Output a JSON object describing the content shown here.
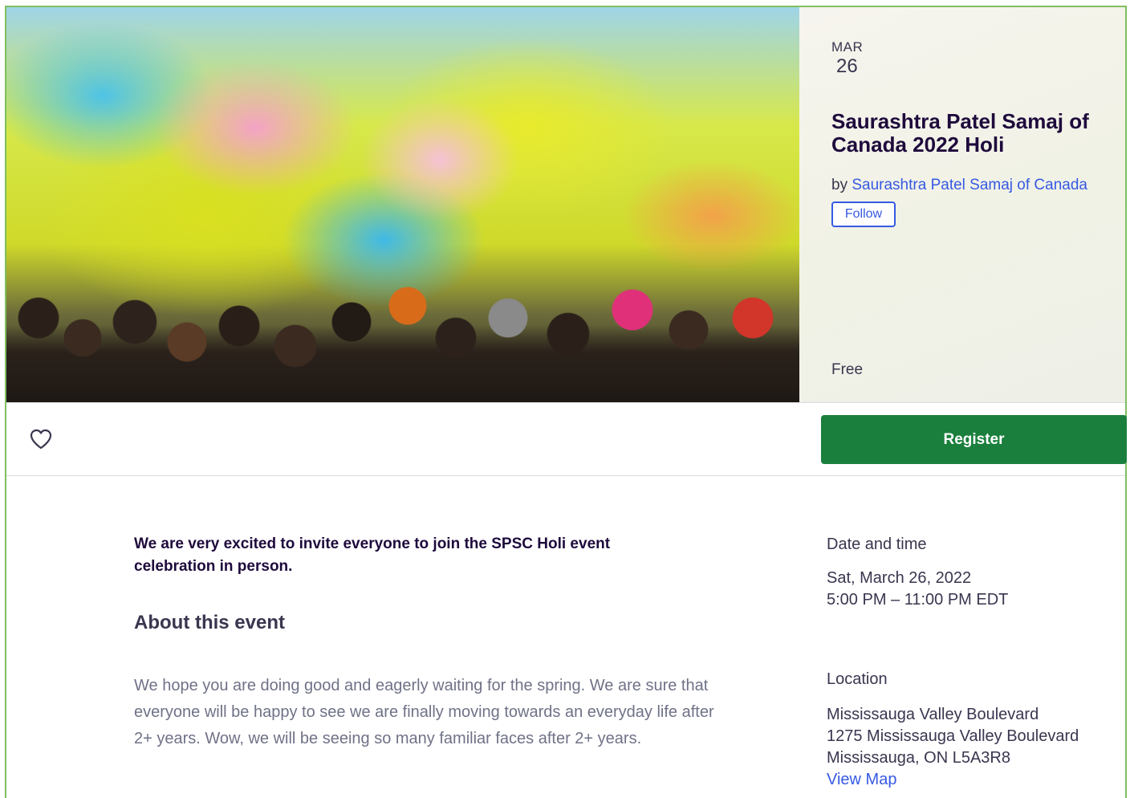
{
  "event": {
    "month": "MAR",
    "day": "26",
    "title": "Saurashtra Patel Samaj of Canada 2022 Holi",
    "by_prefix": "by",
    "organizer": "Saurashtra Patel Samaj of Canada",
    "follow_label": "Follow",
    "price": "Free"
  },
  "actions": {
    "like_icon": "heart-outline-icon",
    "register_label": "Register"
  },
  "main": {
    "summary": "We are very excited to invite everyone to join the SPSC Holi event celebration in person.",
    "about_heading": "About this event",
    "about_body": "We hope you are doing good and eagerly waiting for the spring. We are sure that everyone will be happy to see we are finally moving towards an everyday life after 2+ years. Wow, we will be seeing so many familiar faces after 2+ years."
  },
  "sidebar": {
    "date_heading": "Date and time",
    "date_line": "Sat, March 26, 2022",
    "time_line": "5:00 PM – 11:00 PM EDT",
    "location_heading": "Location",
    "venue_name": "Mississauga Valley Boulevard",
    "address_line": "1275 Mississauga Valley Boulevard",
    "city_line": "Mississauga, ON L5A3R8",
    "view_map_label": "View Map"
  },
  "colors": {
    "register_green": "#1a7f3c",
    "link_blue": "#3659e3",
    "frame_green": "#7fbf5f"
  }
}
